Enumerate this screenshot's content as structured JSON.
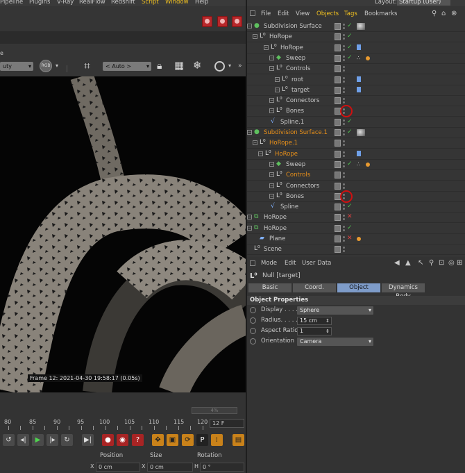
{
  "menu": {
    "items": [
      "Pipeline",
      "Plugins",
      "V-Ray",
      "RealFlow",
      "Redshift",
      "Script",
      "Window",
      "Help"
    ],
    "layout_label": "Layout:",
    "layout_value": "Startup (User)"
  },
  "viewport": {
    "display_mode": "uty",
    "zoom_mode": "< Auto >",
    "frame_info": "Frame  12:  2021-04-30  19:58:17  (0.05s)",
    "progress_label": "4%"
  },
  "timeline": {
    "ticks": [
      "80",
      "85",
      "90",
      "95",
      "100",
      "105",
      "110",
      "115",
      "120"
    ],
    "fps_field": "12 F"
  },
  "coordinates": {
    "headers": [
      "Position",
      "Size",
      "Rotation"
    ],
    "fields": [
      {
        "axis": "X",
        "value": "0 cm"
      },
      {
        "axis": "X",
        "value": "0 cm"
      },
      {
        "axis": "H",
        "value": "0 °"
      }
    ]
  },
  "object_manager": {
    "menu": [
      "File",
      "Edit",
      "View",
      "Objects",
      "Tags",
      "Bookmarks"
    ],
    "rows": [
      {
        "label": "Subdivision Surface",
        "status": "check",
        "highlighted": false
      },
      {
        "label": "HoRope",
        "status": "check",
        "highlighted": false
      },
      {
        "label": "HoRope",
        "status": "check",
        "highlighted": false
      },
      {
        "label": "Sweep",
        "status": "check",
        "highlighted": false
      },
      {
        "label": "Controls",
        "status": "none",
        "highlighted": false
      },
      {
        "label": "root",
        "status": "none",
        "highlighted": false
      },
      {
        "label": "target",
        "status": "none",
        "highlighted": false
      },
      {
        "label": "Connectors",
        "status": "none",
        "highlighted": false
      },
      {
        "label": "Bones",
        "status": "none",
        "highlighted": false
      },
      {
        "label": "Spline.1",
        "status": "check",
        "highlighted": false
      },
      {
        "label": "Subdivision Surface.1",
        "status": "check",
        "highlighted": true
      },
      {
        "label": "HoRope.1",
        "status": "none",
        "highlighted": true
      },
      {
        "label": "HoRope",
        "status": "none",
        "highlighted": true
      },
      {
        "label": "Sweep",
        "status": "check",
        "highlighted": false
      },
      {
        "label": "Controls",
        "status": "none",
        "highlighted": true
      },
      {
        "label": "Connectors",
        "status": "none",
        "highlighted": false
      },
      {
        "label": "Bones",
        "status": "none",
        "highlighted": false
      },
      {
        "label": "Spline",
        "status": "check",
        "highlighted": false
      },
      {
        "label": "HoRope",
        "status": "cross",
        "highlighted": false
      },
      {
        "label": "HoRope",
        "status": "check",
        "highlighted": false
      },
      {
        "label": "Plane",
        "status": "cross",
        "highlighted": false
      },
      {
        "label": "Scene",
        "status": "none",
        "highlighted": false
      }
    ]
  },
  "attribute_manager": {
    "menu": [
      "Mode",
      "Edit",
      "User Data"
    ],
    "title": "Null [target]",
    "tabs": [
      "Basic",
      "Coord.",
      "Object",
      "Dynamics Body"
    ],
    "active_tab": "Object",
    "section": "Object Properties",
    "properties": [
      {
        "label": "Display . . . .",
        "value": "Sphere",
        "kind": "dropdown"
      },
      {
        "label": "Radius. . . . .",
        "value": "15 cm",
        "kind": "number"
      },
      {
        "label": "Aspect Ratio",
        "value": "1",
        "kind": "number"
      },
      {
        "label": "Orientation",
        "value": "Camera",
        "kind": "dropdown"
      }
    ]
  },
  "colors": {
    "highlight_text": "#e8901a",
    "active_menu": "#f0c020",
    "active_tab": "#7e9cc9",
    "annotation_circle": "#d01010"
  }
}
